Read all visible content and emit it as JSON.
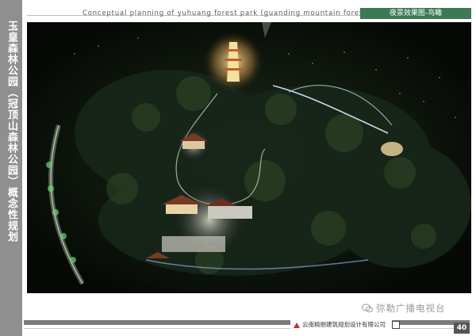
{
  "sidebar": {
    "title": "玉皇森林公园（冠顶山森林公园）概念性规划"
  },
  "header": {
    "subtitle_en": "Conceptual planning of yuhuang forest park (guanding mountain forest park)",
    "tab_label": "夜景效果图-鸟瞰"
  },
  "footer": {
    "company": "云南精朋建筑规划设计有限公司",
    "page_number": "40"
  },
  "watermark": {
    "text": "弥勒广播电视台",
    "icon": "wechat-icon"
  },
  "image": {
    "kind": "aerial-night-rendering"
  },
  "colors": {
    "sidebar": "#8f8f8f",
    "tab": "#3c7a55",
    "night": "#050805"
  }
}
